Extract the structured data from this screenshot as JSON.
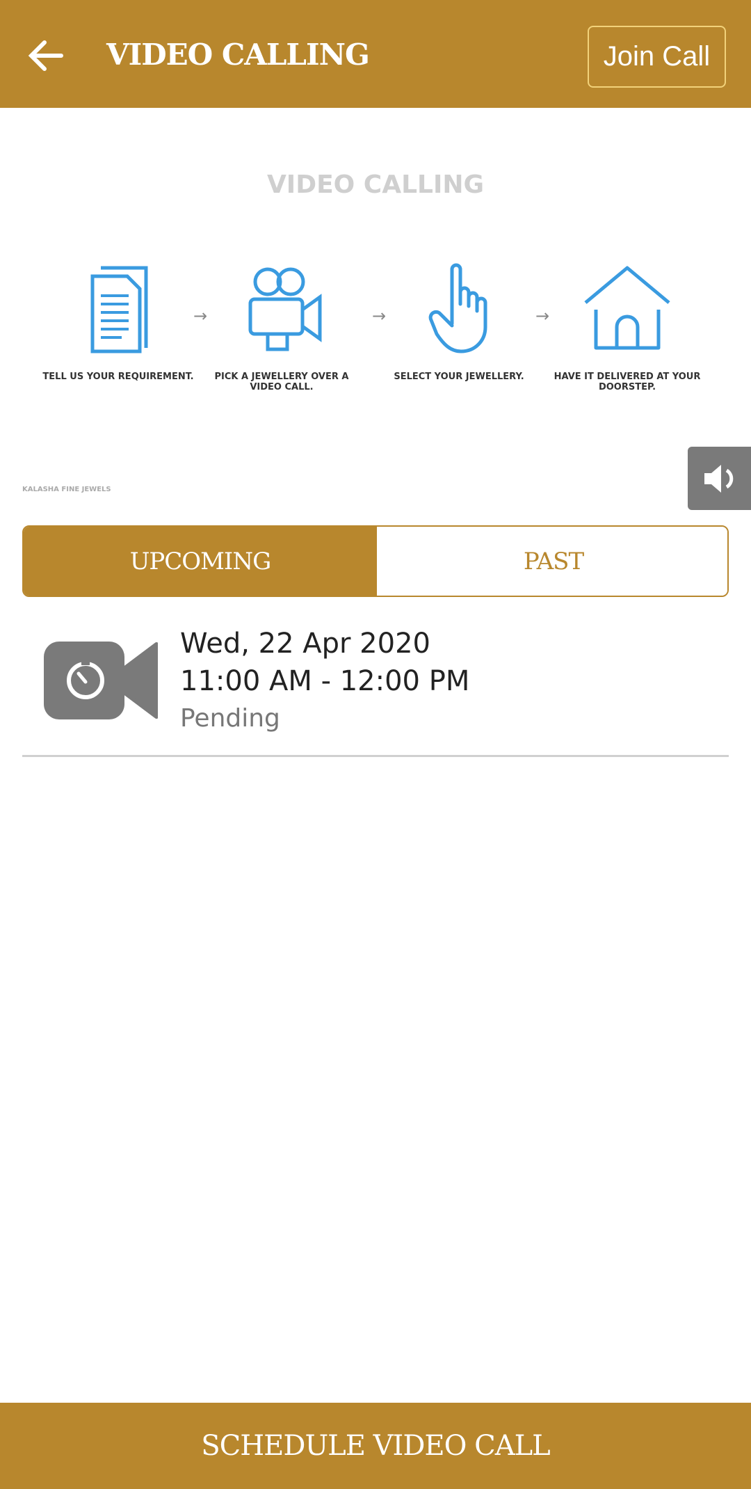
{
  "header": {
    "title": "VIDEO CALLING",
    "join_label": "Join Call"
  },
  "banner": {
    "title": "VIDEO CALLING",
    "steps": [
      {
        "icon": "document-icon",
        "label": "TELL US YOUR REQUIREMENT."
      },
      {
        "icon": "video-camera-icon",
        "label": "PICK A JEWELLERY OVER A VIDEO CALL."
      },
      {
        "icon": "pointing-hand-icon",
        "label": "SELECT YOUR JEWELLERY."
      },
      {
        "icon": "house-icon",
        "label": "HAVE IT DELIVERED AT YOUR DOORSTEP."
      }
    ],
    "brand": "KALASHA FINE JEWELS"
  },
  "tabs": [
    {
      "label": "UPCOMING",
      "active": true
    },
    {
      "label": "PAST",
      "active": false
    }
  ],
  "calls": [
    {
      "date": "Wed, 22 Apr 2020",
      "time": "11:00 AM - 12:00 PM",
      "status": "Pending"
    }
  ],
  "footer": {
    "schedule_label": "SCHEDULE VIDEO CALL"
  },
  "colors": {
    "accent": "#B8872D",
    "icon_blue": "#3A9BE0",
    "gray_icon": "#7a7a7a"
  }
}
